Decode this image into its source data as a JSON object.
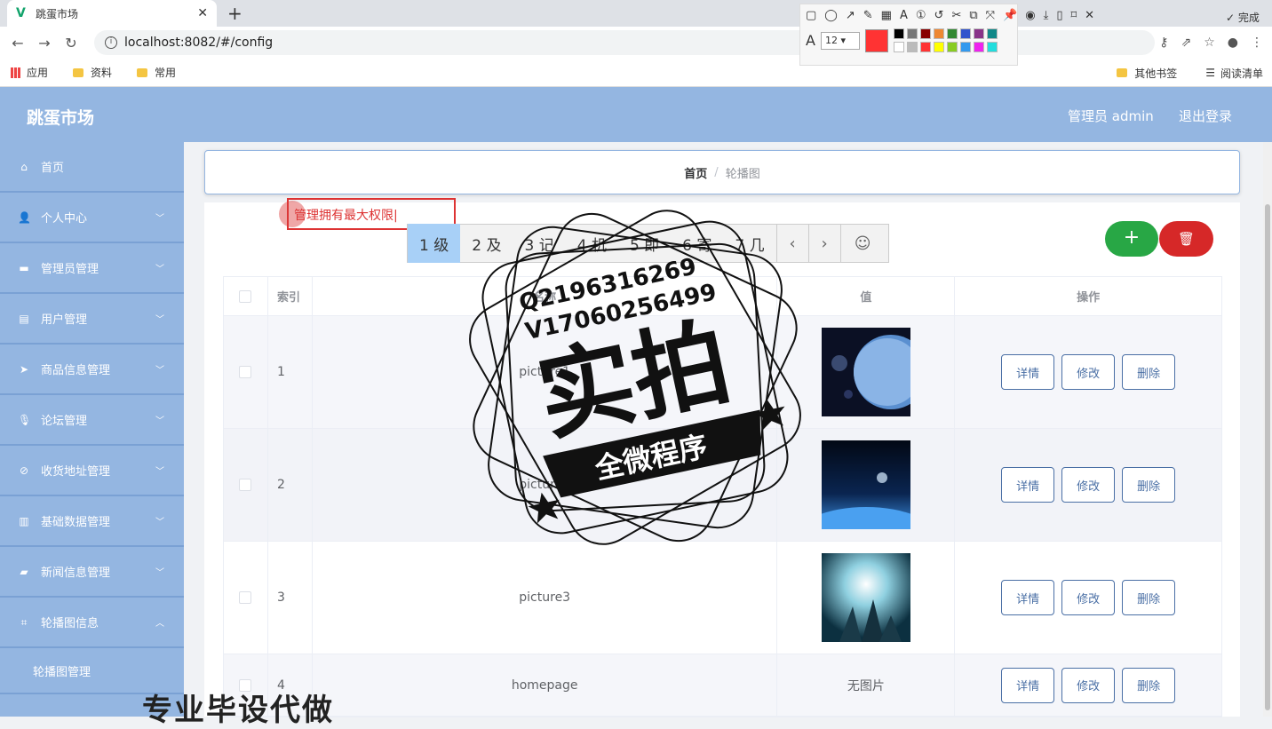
{
  "browser": {
    "tab_title": "跳蛋市场",
    "url": "localhost:8082/#/config",
    "bookmarks": [
      "应用",
      "资料",
      "常用"
    ],
    "bookmarks_right": [
      "其他书签",
      "阅读清单"
    ]
  },
  "annotation_toolbar": {
    "font_size": "12",
    "done_label": "完成",
    "active_color": "#ff3333"
  },
  "header": {
    "brand": "跳蛋市场",
    "admin_label": "管理员 admin",
    "logout_label": "退出登录"
  },
  "sidebar": {
    "items": [
      {
        "label": "首页",
        "icon": "home-icon"
      },
      {
        "label": "个人中心",
        "icon": "user-icon"
      },
      {
        "label": "管理员管理",
        "icon": "admin-icon"
      },
      {
        "label": "用户管理",
        "icon": "briefcase-icon"
      },
      {
        "label": "商品信息管理",
        "icon": "send-icon"
      },
      {
        "label": "论坛管理",
        "icon": "microphone-icon"
      },
      {
        "label": "收货地址管理",
        "icon": "compass-icon"
      },
      {
        "label": "基础数据管理",
        "icon": "clipboard-icon"
      },
      {
        "label": "新闻信息管理",
        "icon": "chat-icon"
      },
      {
        "label": "轮播图信息",
        "icon": "crop-icon"
      }
    ],
    "sub_item": "轮播图管理"
  },
  "breadcrumb": {
    "home": "首页",
    "separator": "/",
    "current": "轮播图"
  },
  "actions": {
    "add_symbol": "+",
    "delete_symbol": "🗑"
  },
  "table": {
    "headers": {
      "index": "索引",
      "name": "名称",
      "value": "值",
      "ops": "操作"
    },
    "rows": [
      {
        "index": "1",
        "name": "picture1",
        "value": "",
        "has_image": true
      },
      {
        "index": "2",
        "name": "picture2",
        "value": "",
        "has_image": true
      },
      {
        "index": "3",
        "name": "picture3",
        "value": "",
        "has_image": true
      },
      {
        "index": "4",
        "name": "homepage",
        "value": "无图片",
        "has_image": false
      }
    ],
    "op_labels": {
      "detail": "详情",
      "edit": "修改",
      "remove": "删除"
    }
  },
  "annotation_text": "管理拥有最大权限",
  "ime": {
    "candidates": [
      "1 级",
      "2 及",
      "3 记",
      "4 机",
      "5 即",
      "6 寄",
      "7 几"
    ]
  },
  "watermark": {
    "line1": "Q2196316269",
    "line2": "V17060256499",
    "big": "实拍",
    "ribbon": "全微程序",
    "bottom": "专业毕设代做"
  }
}
